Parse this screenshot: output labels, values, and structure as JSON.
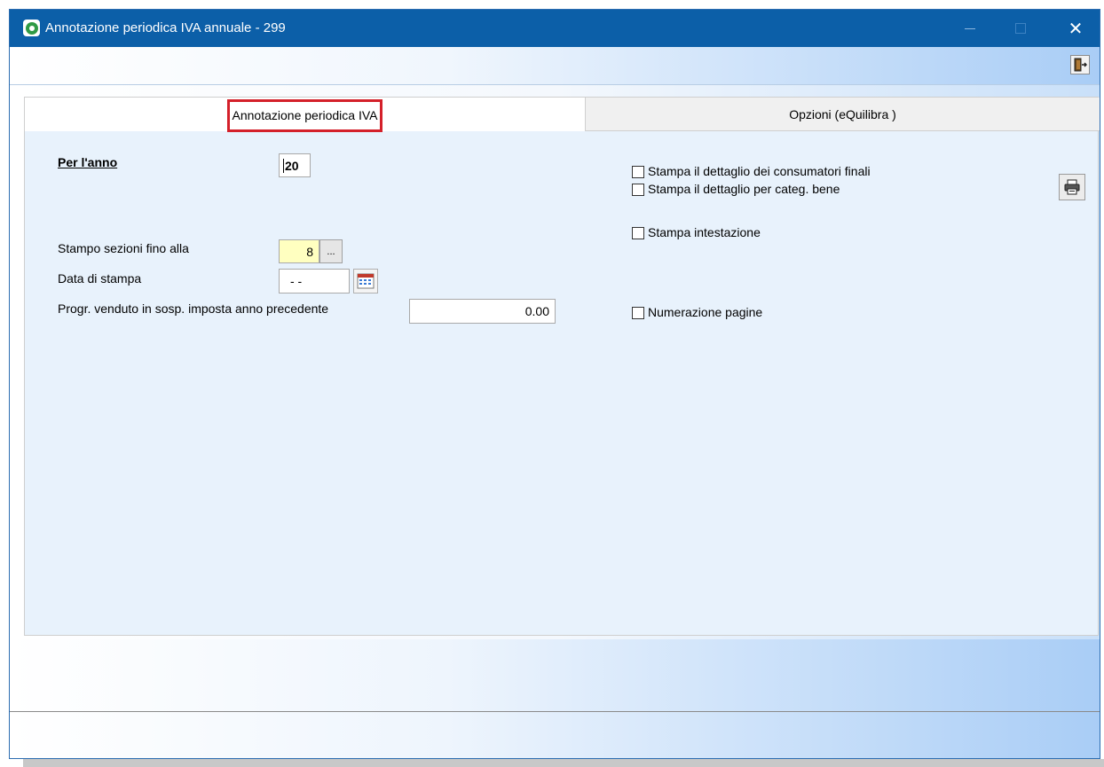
{
  "window": {
    "title": "Annotazione periodica IVA annuale - 299",
    "close_glyph": "✕"
  },
  "toolbar": {
    "exit_icon": "exit-door-icon"
  },
  "tabs": [
    {
      "label": "Annotazione periodica IVA",
      "active": true
    },
    {
      "label": "Opzioni (eQuilibra )",
      "active": false
    }
  ],
  "form": {
    "anno_label": "Per l'anno",
    "anno_value": "20",
    "stampo_label": "Stampo sezioni fino alla",
    "stampo_value": "8",
    "stampo_button": "...",
    "data_label": "Data di stampa",
    "data_value": "- -",
    "progr_label": "Progr. venduto in sosp. imposta anno precedente",
    "progr_value": "0.00"
  },
  "options": {
    "consumatori_label": "Stampa il dettaglio dei consumatori finali",
    "categ_label": "Stampa il dettaglio per categ. bene",
    "intestazione_label": "Stampa intestazione",
    "numerazione_label": "Numerazione pagine"
  },
  "colors": {
    "titlebar": "#0c5fa8",
    "highlight_border": "#d4202a",
    "field_yellow": "#ffffc0"
  }
}
